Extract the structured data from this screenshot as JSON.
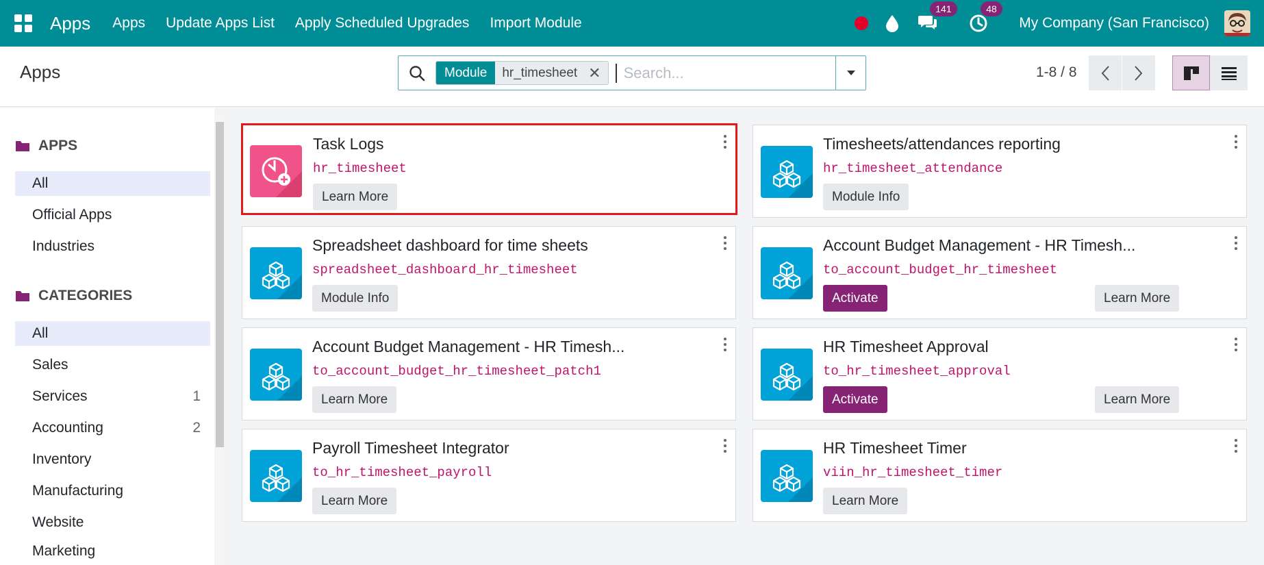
{
  "navbar": {
    "brand": "Apps",
    "menu": [
      "Apps",
      "Update Apps List",
      "Apply Scheduled Upgrades",
      "Import Module"
    ],
    "messages_count": "141",
    "activities_count": "48",
    "company": "My Company (San Francisco)",
    "bg_color": "#018d96",
    "badge_color": "#872374"
  },
  "control": {
    "title": "Apps",
    "facet_label": "Module",
    "facet_value": "hr_timesheet",
    "search_placeholder": "Search...",
    "pager": "1-8 / 8"
  },
  "sidebar": {
    "apps_heading": "APPS",
    "apps_items": [
      {
        "label": "All",
        "count": ""
      },
      {
        "label": "Official Apps",
        "count": ""
      },
      {
        "label": "Industries",
        "count": ""
      }
    ],
    "categories_heading": "CATEGORIES",
    "category_items": [
      {
        "label": "All",
        "count": ""
      },
      {
        "label": "Sales",
        "count": ""
      },
      {
        "label": "Services",
        "count": "1"
      },
      {
        "label": "Accounting",
        "count": "2"
      },
      {
        "label": "Inventory",
        "count": ""
      },
      {
        "label": "Manufacturing",
        "count": ""
      },
      {
        "label": "Website",
        "count": ""
      },
      {
        "label": "Marketing",
        "count": ""
      }
    ]
  },
  "cards": [
    {
      "title": "Task Logs",
      "code": "hr_timesheet",
      "buttons": [
        "Learn More"
      ],
      "icon": "task-logs-icon"
    },
    {
      "title": "Timesheets/attendances reporting",
      "code": "hr_timesheet_attendance",
      "buttons": [
        "Module Info"
      ],
      "icon": "module-cubes-icon"
    },
    {
      "title": "Spreadsheet dashboard for time sheets",
      "code": "spreadsheet_dashboard_hr_timesheet",
      "buttons": [
        "Module Info"
      ],
      "icon": "module-cubes-icon"
    },
    {
      "title": "Account Budget Management - HR Timesh...",
      "code": "to_account_budget_hr_timesheet",
      "buttons": [
        "Activate",
        "Learn More"
      ],
      "icon": "module-cubes-icon"
    },
    {
      "title": "Account Budget Management - HR Timesh...",
      "code": "to_account_budget_hr_timesheet_patch1",
      "buttons": [
        "Learn More"
      ],
      "icon": "module-cubes-icon"
    },
    {
      "title": "HR Timesheet Approval",
      "code": "to_hr_timesheet_approval",
      "buttons": [
        "Activate",
        "Learn More"
      ],
      "icon": "module-cubes-icon"
    },
    {
      "title": "Payroll Timesheet Integrator",
      "code": "to_hr_timesheet_payroll",
      "buttons": [
        "Learn More"
      ],
      "icon": "module-cubes-icon"
    },
    {
      "title": "HR Timesheet Timer",
      "code": "viin_hr_timesheet_timer",
      "buttons": [
        "Learn More"
      ],
      "icon": "module-cubes-icon"
    }
  ]
}
